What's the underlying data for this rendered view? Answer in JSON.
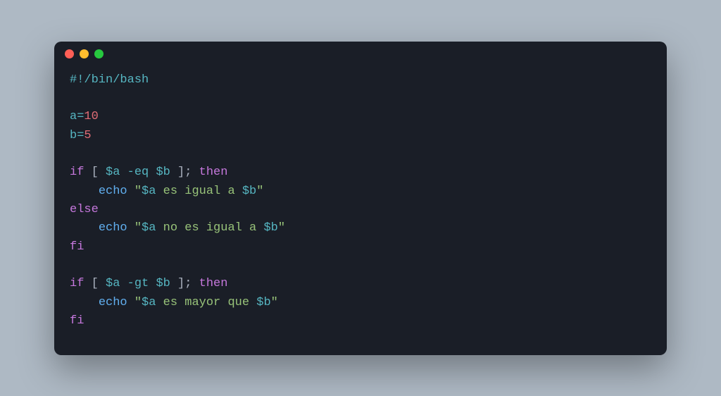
{
  "window": {
    "traffic_lights": [
      "close",
      "minimize",
      "zoom"
    ]
  },
  "code": {
    "shebang": "#!/bin/bash",
    "empty": "",
    "assign_a_var": "a",
    "assign_eq": "=",
    "assign_a_val": "10",
    "assign_b_var": "b",
    "assign_b_val": "5",
    "kw_if": "if",
    "kw_then": "then",
    "kw_else": "else",
    "kw_fi": "fi",
    "bracket_open": "[",
    "bracket_close": "]",
    "semicolon": ";",
    "var_a": "$a",
    "var_b": "$b",
    "op_eq": "-eq",
    "op_gt": "-gt",
    "cmd_echo": "echo",
    "quote": "\"",
    "str_es_igual_a": " es igual a ",
    "str_no_es_igual_a": " no es igual a ",
    "str_es_mayor_que": " es mayor que ",
    "indent": "    ",
    "space": " "
  }
}
